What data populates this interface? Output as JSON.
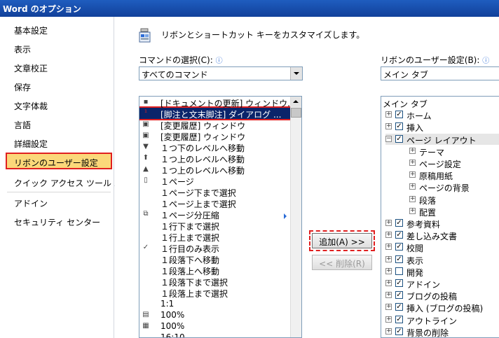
{
  "window": {
    "title": "Word のオプション"
  },
  "nav": {
    "items": [
      "基本設定",
      "表示",
      "文章校正",
      "保存",
      "文字体裁",
      "言語",
      "詳細設定",
      "リボンのユーザー設定",
      "クイック アクセス ツール バー",
      "アドイン",
      "セキュリティ センター"
    ],
    "selected": "リボンのユーザー設定"
  },
  "main": {
    "heading": "リボンとショートカット キーをカスタマイズします。",
    "commands_label": "コマンドの選択(C):",
    "commands_combo": "すべてのコマンド",
    "ribbon_label": "リボンのユーザー設定(B):",
    "ribbon_combo": "メイン タブ",
    "info_icon": "ⓘ"
  },
  "commands": [
    {
      "icon": "▪",
      "label": "[ドキュメントの更新] ウィンドウ..."
    },
    {
      "icon": "¹",
      "label": "[脚注と文末脚注] ダイアログ ...",
      "selected": true
    },
    {
      "icon": "▣",
      "label": "[変更履歴] ウィンドウ"
    },
    {
      "icon": "▣",
      "label": "[変更履歴] ウィンドウ"
    },
    {
      "icon": "▼",
      "label": "１つ下のレベルへ移動"
    },
    {
      "icon": "⬆",
      "label": "１つ上のレベルへ移動"
    },
    {
      "icon": "▲",
      "label": "１つ上のレベルへ移動"
    },
    {
      "icon": "▯",
      "label": "１ページ"
    },
    {
      "icon": "",
      "label": "１ページ下まで選択"
    },
    {
      "icon": "",
      "label": "１ページ上まで選択"
    },
    {
      "icon": "⧉",
      "label": "１ページ分圧縮"
    },
    {
      "icon": "",
      "label": "１行下まで選択"
    },
    {
      "icon": "",
      "label": "１行上まで選択"
    },
    {
      "icon": "✓",
      "label": "１行目のみ表示"
    },
    {
      "icon": "",
      "label": "１段落下へ移動"
    },
    {
      "icon": "",
      "label": "１段落上へ移動"
    },
    {
      "icon": "",
      "label": "１段落下まで選択"
    },
    {
      "icon": "",
      "label": "１段落上まで選択"
    },
    {
      "icon": "",
      "label": "1:1"
    },
    {
      "icon": "▤",
      "label": "100%"
    },
    {
      "icon": "▦",
      "label": "100%"
    },
    {
      "icon": "",
      "label": "16:10"
    }
  ],
  "buttons": {
    "add": "追加(A) >>",
    "remove": "<< 削除(R)"
  },
  "ribbon_tree": [
    {
      "label": "メイン タブ",
      "level": 0,
      "header": true
    },
    {
      "label": "ホーム",
      "level": 1,
      "exp": "+",
      "checked": true
    },
    {
      "label": "挿入",
      "level": 1,
      "exp": "+",
      "checked": true
    },
    {
      "label": "ページ レイアウト",
      "level": 1,
      "exp": "−",
      "checked": true,
      "hilite": true
    },
    {
      "label": "テーマ",
      "level": 2,
      "exp": "+"
    },
    {
      "label": "ページ設定",
      "level": 2,
      "exp": "+"
    },
    {
      "label": "原稿用紙",
      "level": 2,
      "exp": "+"
    },
    {
      "label": "ページの背景",
      "level": 2,
      "exp": "+"
    },
    {
      "label": "段落",
      "level": 2,
      "exp": "+"
    },
    {
      "label": "配置",
      "level": 2,
      "exp": "+"
    },
    {
      "label": "参考資料",
      "level": 1,
      "exp": "+",
      "checked": true
    },
    {
      "label": "差し込み文書",
      "level": 1,
      "exp": "+",
      "checked": true
    },
    {
      "label": "校閲",
      "level": 1,
      "exp": "+",
      "checked": true
    },
    {
      "label": "表示",
      "level": 1,
      "exp": "+",
      "checked": true
    },
    {
      "label": "開発",
      "level": 1,
      "exp": "+",
      "checked": false
    },
    {
      "label": "アドイン",
      "level": 1,
      "exp": "+",
      "checked": true
    },
    {
      "label": "ブログの投稿",
      "level": 1,
      "exp": "+",
      "checked": true
    },
    {
      "label": "挿入 (ブログの投稿)",
      "level": 1,
      "exp": "+",
      "checked": true
    },
    {
      "label": "アウトライン",
      "level": 1,
      "exp": "+",
      "checked": true
    },
    {
      "label": "背景の削除",
      "level": 1,
      "exp": "+",
      "checked": true
    }
  ]
}
